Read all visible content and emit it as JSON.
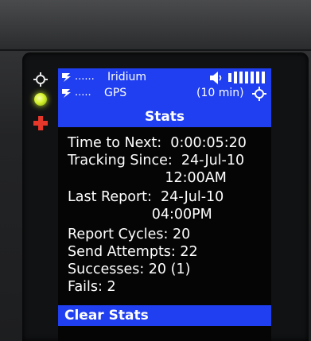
{
  "status": {
    "iridium_dots": "......",
    "iridium_label": "Iridium",
    "gps_dots": ".....",
    "gps_label": "GPS",
    "interval": "(10 min)"
  },
  "title": "Stats",
  "stats_lines": [
    "Time to Next:  0:00:05:20",
    "Tracking Since:  24-Jul-10",
    "                      12:00AM",
    "Last Report:  24-Jul-10",
    "                   04:00PM",
    "Report Cycles: 20",
    "Send Attempts: 22",
    "Successes: 20 (1)",
    "Fails: 2"
  ],
  "footer_action": "Clear Stats",
  "colors": {
    "screen_blue": "#1f3ff0",
    "screen_bg": "#050505",
    "led_green": "#d6f32b",
    "led_red": "#e6372b"
  },
  "icons": [
    "target-icon",
    "status-led",
    "emergency-cross-icon",
    "satellite-icon",
    "speaker-icon",
    "signal-bars-icon",
    "gps-target-icon"
  ]
}
